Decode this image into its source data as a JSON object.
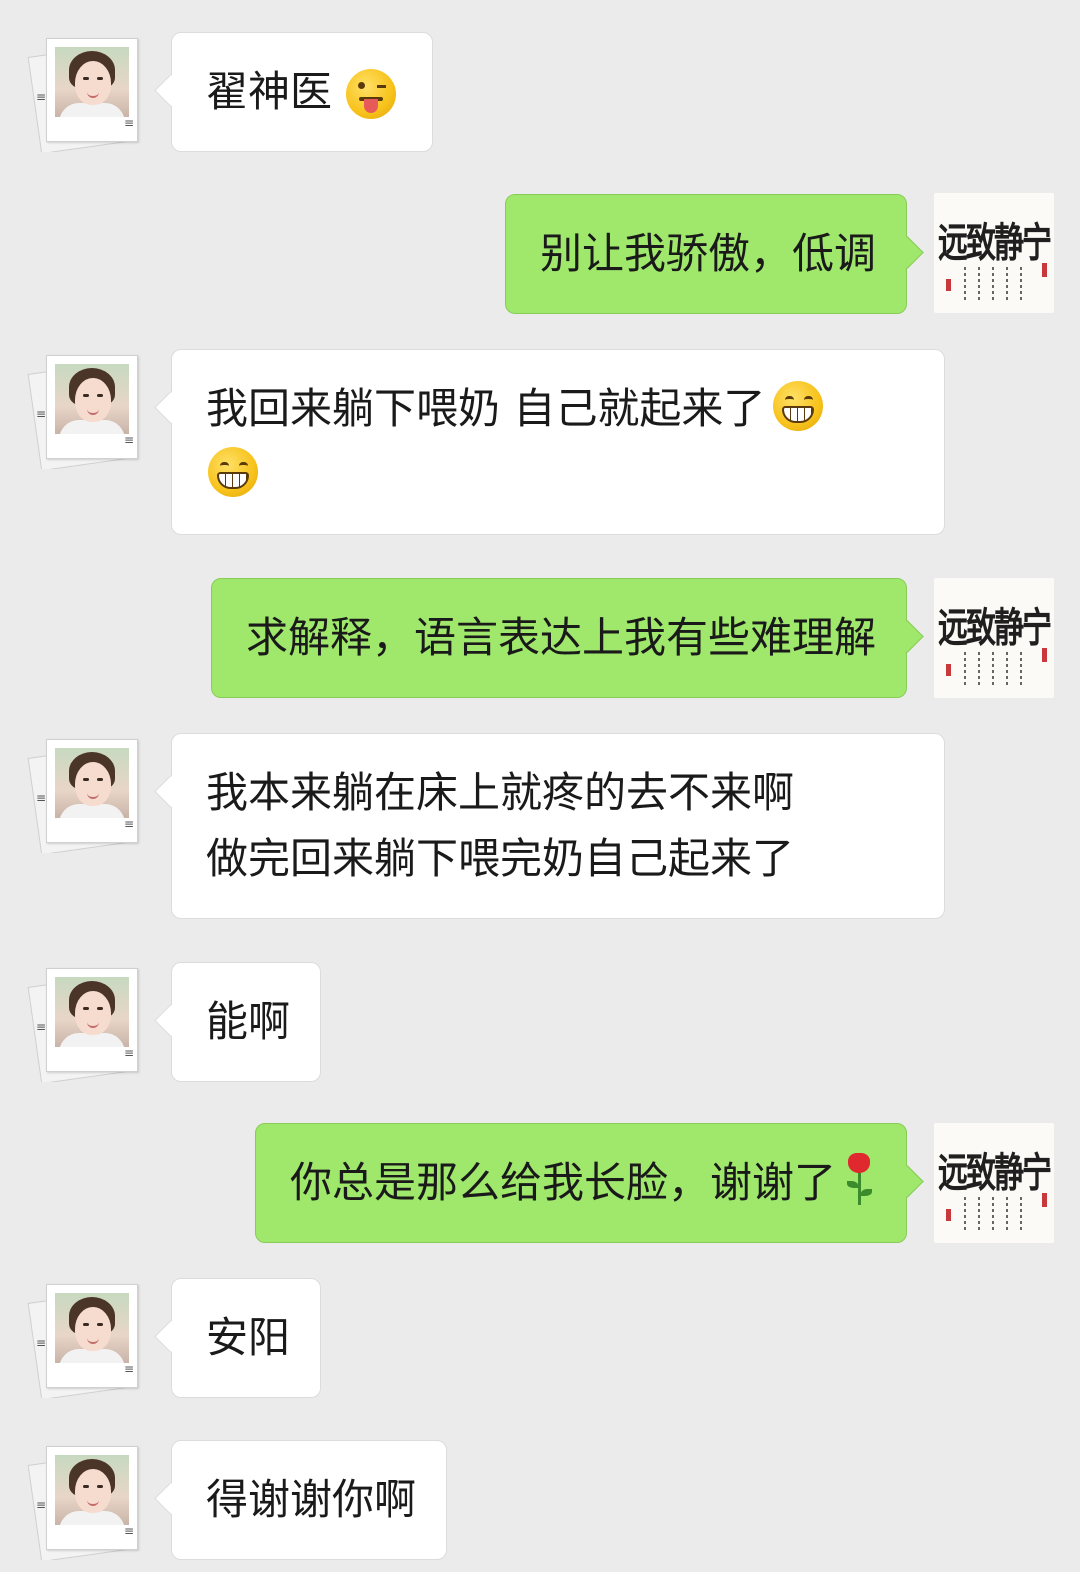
{
  "messages": [
    {
      "side": "recv",
      "lines": [
        "翟神医"
      ],
      "emoji": "wink"
    },
    {
      "side": "sent",
      "lines": [
        "别让我骄傲，低调"
      ]
    },
    {
      "side": "recv",
      "lines": [
        "我回来躺下喂奶 自己就起来了"
      ],
      "emoji": "grin",
      "emoji2": "grin"
    },
    {
      "side": "sent",
      "lines": [
        "求解释，语言表达上我有些难理解"
      ]
    },
    {
      "side": "recv",
      "lines": [
        "我本来躺在床上就疼的去不来啊",
        "做完回来躺下喂完奶自己起来了"
      ]
    },
    {
      "side": "recv",
      "lines": [
        "能啊"
      ]
    },
    {
      "side": "sent",
      "lines": [
        "你总是那么给我长脸，谢谢了"
      ],
      "emoji": "rose"
    },
    {
      "side": "recv",
      "lines": [
        "安阳"
      ]
    },
    {
      "side": "recv",
      "lines": [
        "得谢谢你啊"
      ]
    }
  ],
  "avatars": {
    "friend": {
      "icon": "woman-photo-avatar"
    },
    "self": {
      "icon": "calligraphy-avatar",
      "calligraphy": [
        "宁",
        "静",
        "致",
        "远"
      ]
    }
  },
  "colors": {
    "background": "#ebebeb",
    "sent_bubble": "#9fe86c",
    "recv_bubble": "#ffffff"
  }
}
